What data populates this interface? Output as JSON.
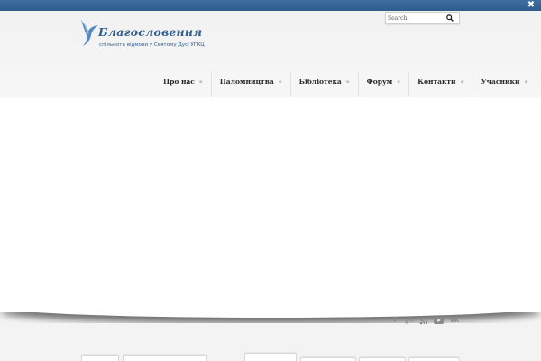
{
  "close": {
    "icon": "close-icon",
    "glyph": "✖"
  },
  "logo": {
    "title": "Благословення",
    "subtitle": "спільнота відмови у Святому Дусі УГКЦ",
    "icon": "dove-icon",
    "color": "#2e5d8e"
  },
  "search": {
    "placeholder": "Search",
    "icon": "search-icon"
  },
  "nav": {
    "items": [
      {
        "label": "Про нас"
      },
      {
        "label": "Паломництва"
      },
      {
        "label": "Бібліотека"
      },
      {
        "label": "Форум"
      },
      {
        "label": "Контакти"
      },
      {
        "label": "Учасники"
      }
    ],
    "arrow": "◆"
  },
  "social": {
    "facebook": "f",
    "googleplus": "g+",
    "rss": "rss-icon",
    "youtube": "youtube-icon",
    "vk": "vk"
  },
  "colors": {
    "topbar": "#2f5b8a",
    "accent": "#2e5d8e"
  }
}
